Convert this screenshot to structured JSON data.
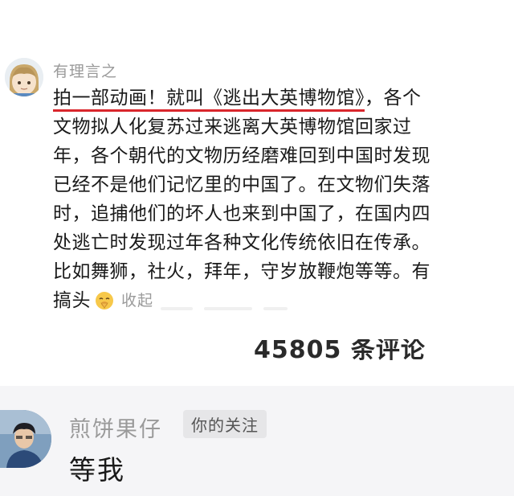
{
  "top_comment": {
    "username": "有理言之",
    "lines": [
      "拍一部动画！就叫《逃出大英博物馆》，各个",
      "文物拟人化复苏过来逃离大英博物馆回家过",
      "年，各个朝代的文物历经磨难回到中国时发现",
      "已经不是他们记忆里的中国了。在文物们失落",
      "时，追捕他们的坏人也来到中国了，在国内四",
      "处逃亡时发现过年各种文化传统依旧在传承。",
      "比如舞狮，社火，拜年，守岁放鞭炮等等。有"
    ],
    "underlined_text": "拍一部动画！就叫《逃出大英博物馆》",
    "after_underline": "，各个",
    "last_line_text": "搞头",
    "emoji_icon": "praying-face-emoji",
    "collapse_label": "收起",
    "comment_count": "45805 条评论"
  },
  "reply": {
    "username": "煎饼果仔",
    "badge": "你的关注",
    "text": "等我"
  },
  "colors": {
    "underline": "#d9262c",
    "muted_text": "#9a9a9a",
    "reply_bg": "#f5f5f7"
  }
}
